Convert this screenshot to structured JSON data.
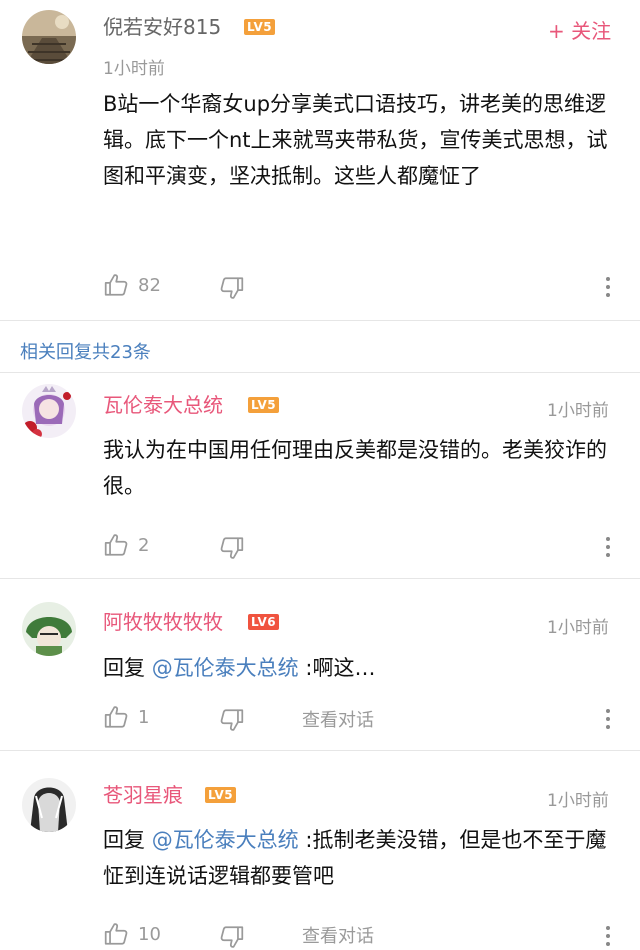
{
  "main_comment": {
    "username": "倪若安好815",
    "level": "LV5",
    "follow": "+ 关注",
    "time": "1小时前",
    "text": "B站一个华裔女up分享美式口语技巧，讲老美的思维逻辑。底下一个nt上来就骂夹带私货，宣传美式思想，试图和平演变，坚决抵制。这些人都魔怔了",
    "likes": "82"
  },
  "replies_header": "相关回复共23条",
  "replies": [
    {
      "username": "瓦伦泰大总统",
      "level": "LV5",
      "time": "1小时前",
      "text": "我认为在中国用任何理由反美都是没错的。老美狡诈的很。",
      "likes": "2"
    },
    {
      "username": "阿牧牧牧牧牧",
      "level": "LV6",
      "time": "1小时前",
      "reply_prefix": "回复 ",
      "mention": "@瓦伦泰大总统",
      "text": " :啊这…",
      "likes": "1",
      "view_thread": "查看对话"
    },
    {
      "username": "苍羽星痕",
      "level": "LV5",
      "time": "1小时前",
      "reply_prefix": "回复 ",
      "mention": "@瓦伦泰大总统",
      "text": " :抵制老美没错，但是也不至于魔怔到连说话逻辑都要管吧",
      "likes": "10",
      "view_thread": "查看对话"
    }
  ],
  "colors": {
    "username_main": "#666666",
    "username_reply": "#e8577a",
    "mention": "#4a7fbd",
    "lv5": "#f4a03b",
    "lv6": "#f0533f",
    "follow": "#e8577a"
  },
  "icons": [
    "thumb-up-icon",
    "thumb-down-icon",
    "more-vertical-icon"
  ]
}
